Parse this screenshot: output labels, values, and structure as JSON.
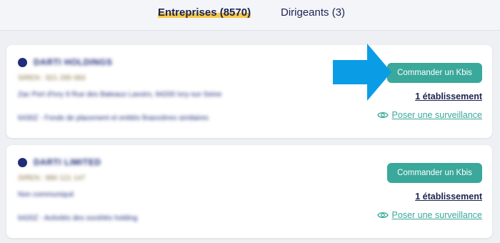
{
  "tabs": [
    {
      "label": "Entreprises (8570)",
      "active": true
    },
    {
      "label": "Dirigeants (3)",
      "active": false
    }
  ],
  "companies": [
    {
      "name": "DARTI HOLDINGS",
      "siren": "SIREN : 921 295 083",
      "address": "Zac Port d'Ivry 9 Rue des Bateaux Lavoirs, 94200 Ivry-sur-Seine",
      "activity": "6430Z - Fonds de placement et entités financières similaires",
      "kbis_label": "Commander un Kbis",
      "establishments_label": "1 établissement",
      "watch_label": "Poser une surveillance"
    },
    {
      "name": "DARTI LIMITED",
      "siren": "SIREN : 880 121 147",
      "address": "Non communiqué",
      "activity": "6420Z - Activités des sociétés holding",
      "kbis_label": "Commander un Kbis",
      "establishments_label": "1 établissement",
      "watch_label": "Poser une surveillance"
    }
  ],
  "colors": {
    "accent": "#3aa89a",
    "navy": "#1c2350",
    "highlight": "#f7c84a",
    "arrow": "#0a9de6"
  },
  "icons": {
    "company": "building-circle-icon",
    "watch": "eye-icon",
    "pointer": "arrow-right-icon"
  }
}
